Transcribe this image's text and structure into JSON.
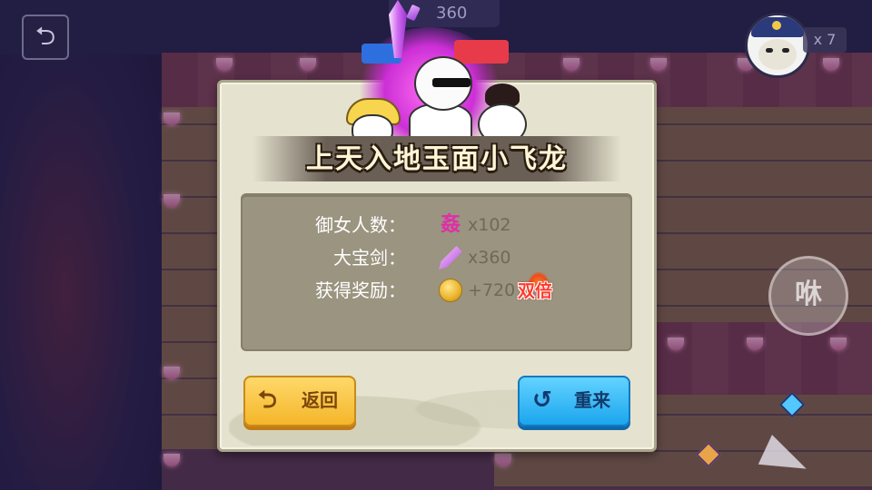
{
  "hud": {
    "back_icon": "back-arrow-icon",
    "sword_count": "360",
    "lives": "x 7",
    "action_button_label": "咻"
  },
  "dialog": {
    "title": "上天入地玉面小飞龙",
    "stats": [
      {
        "label": "御女人数：",
        "icon": "jian-character-icon",
        "icon_text": "姦",
        "value": "x102"
      },
      {
        "label": "大宝剑：",
        "icon": "purple-sword-icon",
        "value": "x360"
      },
      {
        "label": "获得奖励：",
        "icon": "gold-coin-icon",
        "value": "+720"
      }
    ],
    "double_badge": "双倍",
    "back_button": {
      "icon": "return-arrow-icon",
      "label": "返回",
      "icon_glyph": "⮌"
    },
    "retry_button": {
      "icon": "restart-icon",
      "label": "重来",
      "icon_glyph": "↺"
    }
  },
  "colors": {
    "dialog_bg": "#e5e3cf",
    "stats_panel": "#9a9480",
    "back_button": "#f4b62a",
    "retry_button": "#1ba6ee",
    "double_text": "#ff3a2a",
    "glow": "#cc2fd6"
  }
}
